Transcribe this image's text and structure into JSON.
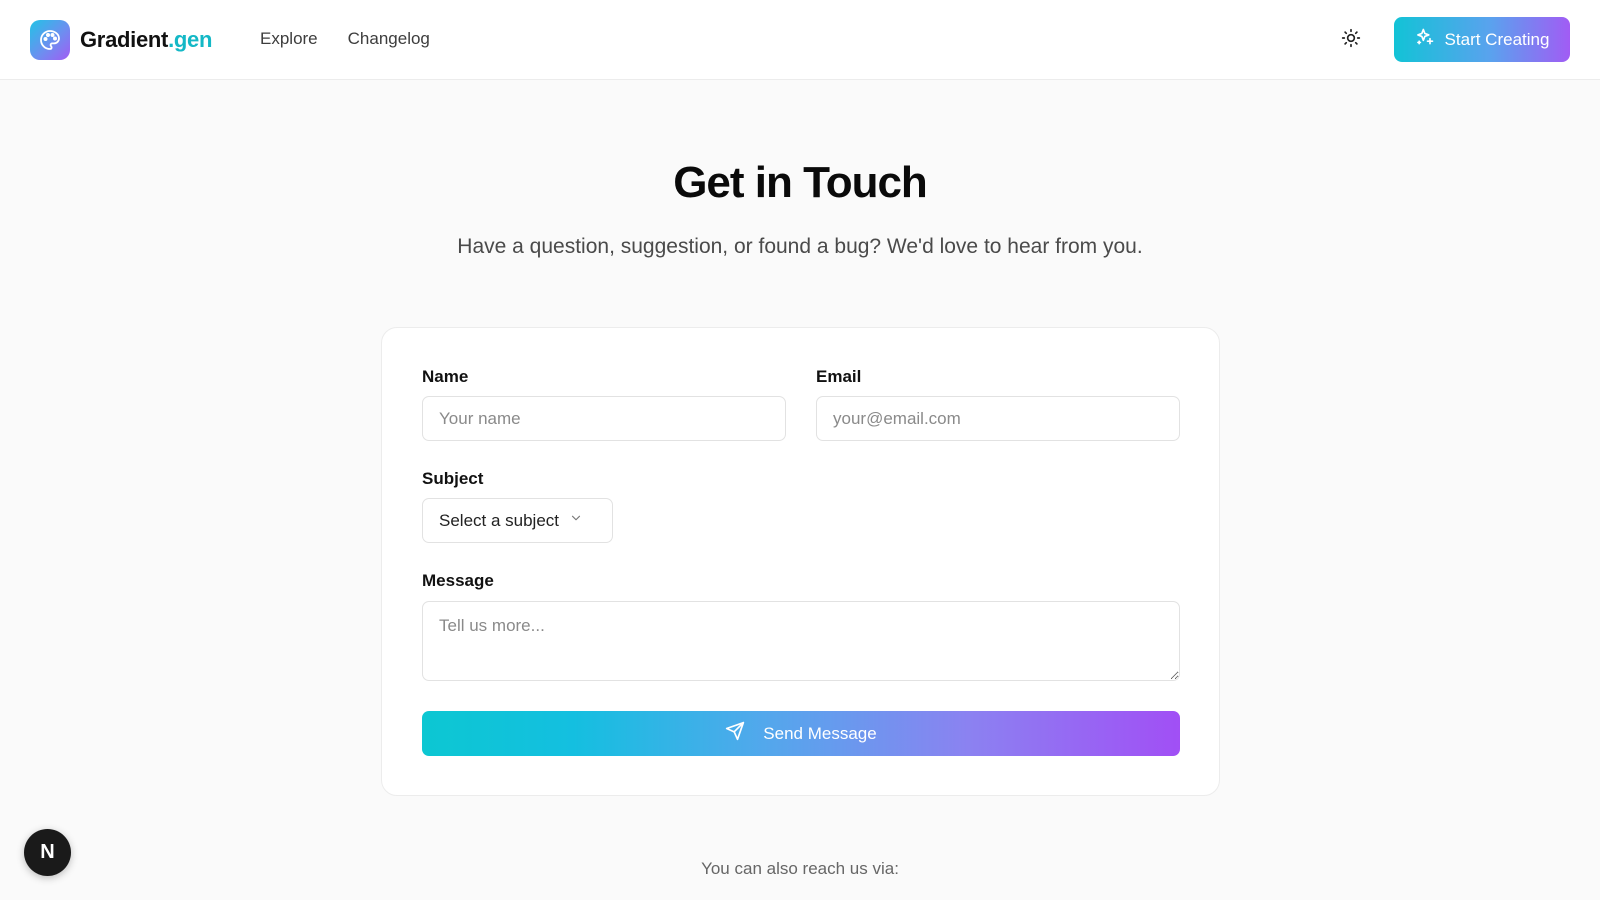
{
  "header": {
    "brand": {
      "name": "Gradient",
      "suffix": ".gen",
      "accent_color": "#14b8c6"
    },
    "nav": [
      {
        "label": "Explore"
      },
      {
        "label": "Changelog"
      }
    ],
    "theme_toggle_icon": "sun-icon",
    "cta": {
      "label": "Start Creating",
      "icon": "sparkles-icon"
    }
  },
  "hero": {
    "title": "Get in Touch",
    "subtitle": "Have a question, suggestion, or found a bug? We'd love to hear from you."
  },
  "form": {
    "name": {
      "label": "Name",
      "placeholder": "Your name",
      "value": ""
    },
    "email": {
      "label": "Email",
      "placeholder": "your@email.com",
      "value": ""
    },
    "subject": {
      "label": "Subject",
      "selected": "Select a subject"
    },
    "message": {
      "label": "Message",
      "placeholder": "Tell us more...",
      "value": ""
    },
    "submit": {
      "label": "Send Message",
      "icon": "send-icon"
    }
  },
  "footer_note": "You can also reach us via:",
  "dev_badge": {
    "letter": "N"
  },
  "colors": {
    "gradient_start": "#0cc7d2",
    "gradient_end": "#a14ff5"
  }
}
